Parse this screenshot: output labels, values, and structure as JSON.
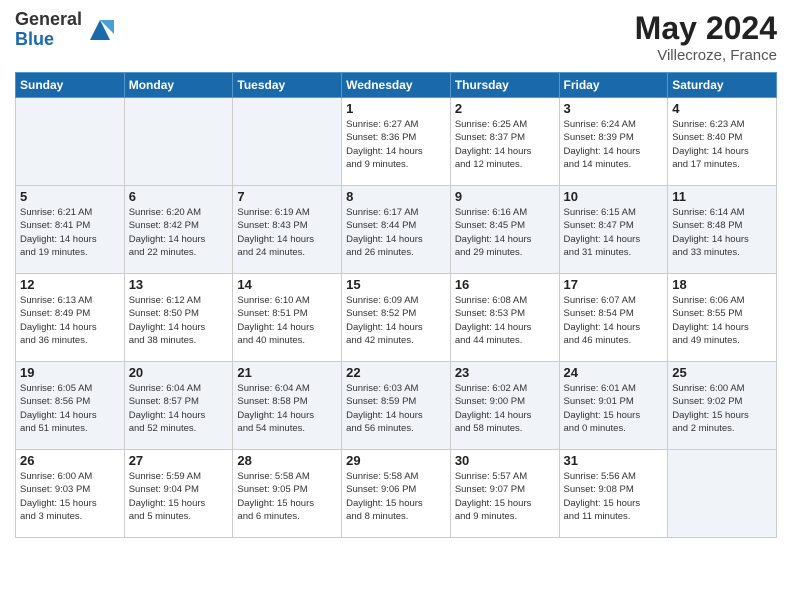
{
  "logo": {
    "general": "General",
    "blue": "Blue"
  },
  "header": {
    "month": "May 2024",
    "location": "Villecroze, France"
  },
  "days_of_week": [
    "Sunday",
    "Monday",
    "Tuesday",
    "Wednesday",
    "Thursday",
    "Friday",
    "Saturday"
  ],
  "weeks": [
    [
      {
        "day": "",
        "info": ""
      },
      {
        "day": "",
        "info": ""
      },
      {
        "day": "",
        "info": ""
      },
      {
        "day": "1",
        "info": "Sunrise: 6:27 AM\nSunset: 8:36 PM\nDaylight: 14 hours\nand 9 minutes."
      },
      {
        "day": "2",
        "info": "Sunrise: 6:25 AM\nSunset: 8:37 PM\nDaylight: 14 hours\nand 12 minutes."
      },
      {
        "day": "3",
        "info": "Sunrise: 6:24 AM\nSunset: 8:39 PM\nDaylight: 14 hours\nand 14 minutes."
      },
      {
        "day": "4",
        "info": "Sunrise: 6:23 AM\nSunset: 8:40 PM\nDaylight: 14 hours\nand 17 minutes."
      }
    ],
    [
      {
        "day": "5",
        "info": "Sunrise: 6:21 AM\nSunset: 8:41 PM\nDaylight: 14 hours\nand 19 minutes."
      },
      {
        "day": "6",
        "info": "Sunrise: 6:20 AM\nSunset: 8:42 PM\nDaylight: 14 hours\nand 22 minutes."
      },
      {
        "day": "7",
        "info": "Sunrise: 6:19 AM\nSunset: 8:43 PM\nDaylight: 14 hours\nand 24 minutes."
      },
      {
        "day": "8",
        "info": "Sunrise: 6:17 AM\nSunset: 8:44 PM\nDaylight: 14 hours\nand 26 minutes."
      },
      {
        "day": "9",
        "info": "Sunrise: 6:16 AM\nSunset: 8:45 PM\nDaylight: 14 hours\nand 29 minutes."
      },
      {
        "day": "10",
        "info": "Sunrise: 6:15 AM\nSunset: 8:47 PM\nDaylight: 14 hours\nand 31 minutes."
      },
      {
        "day": "11",
        "info": "Sunrise: 6:14 AM\nSunset: 8:48 PM\nDaylight: 14 hours\nand 33 minutes."
      }
    ],
    [
      {
        "day": "12",
        "info": "Sunrise: 6:13 AM\nSunset: 8:49 PM\nDaylight: 14 hours\nand 36 minutes."
      },
      {
        "day": "13",
        "info": "Sunrise: 6:12 AM\nSunset: 8:50 PM\nDaylight: 14 hours\nand 38 minutes."
      },
      {
        "day": "14",
        "info": "Sunrise: 6:10 AM\nSunset: 8:51 PM\nDaylight: 14 hours\nand 40 minutes."
      },
      {
        "day": "15",
        "info": "Sunrise: 6:09 AM\nSunset: 8:52 PM\nDaylight: 14 hours\nand 42 minutes."
      },
      {
        "day": "16",
        "info": "Sunrise: 6:08 AM\nSunset: 8:53 PM\nDaylight: 14 hours\nand 44 minutes."
      },
      {
        "day": "17",
        "info": "Sunrise: 6:07 AM\nSunset: 8:54 PM\nDaylight: 14 hours\nand 46 minutes."
      },
      {
        "day": "18",
        "info": "Sunrise: 6:06 AM\nSunset: 8:55 PM\nDaylight: 14 hours\nand 49 minutes."
      }
    ],
    [
      {
        "day": "19",
        "info": "Sunrise: 6:05 AM\nSunset: 8:56 PM\nDaylight: 14 hours\nand 51 minutes."
      },
      {
        "day": "20",
        "info": "Sunrise: 6:04 AM\nSunset: 8:57 PM\nDaylight: 14 hours\nand 52 minutes."
      },
      {
        "day": "21",
        "info": "Sunrise: 6:04 AM\nSunset: 8:58 PM\nDaylight: 14 hours\nand 54 minutes."
      },
      {
        "day": "22",
        "info": "Sunrise: 6:03 AM\nSunset: 8:59 PM\nDaylight: 14 hours\nand 56 minutes."
      },
      {
        "day": "23",
        "info": "Sunrise: 6:02 AM\nSunset: 9:00 PM\nDaylight: 14 hours\nand 58 minutes."
      },
      {
        "day": "24",
        "info": "Sunrise: 6:01 AM\nSunset: 9:01 PM\nDaylight: 15 hours\nand 0 minutes."
      },
      {
        "day": "25",
        "info": "Sunrise: 6:00 AM\nSunset: 9:02 PM\nDaylight: 15 hours\nand 2 minutes."
      }
    ],
    [
      {
        "day": "26",
        "info": "Sunrise: 6:00 AM\nSunset: 9:03 PM\nDaylight: 15 hours\nand 3 minutes."
      },
      {
        "day": "27",
        "info": "Sunrise: 5:59 AM\nSunset: 9:04 PM\nDaylight: 15 hours\nand 5 minutes."
      },
      {
        "day": "28",
        "info": "Sunrise: 5:58 AM\nSunset: 9:05 PM\nDaylight: 15 hours\nand 6 minutes."
      },
      {
        "day": "29",
        "info": "Sunrise: 5:58 AM\nSunset: 9:06 PM\nDaylight: 15 hours\nand 8 minutes."
      },
      {
        "day": "30",
        "info": "Sunrise: 5:57 AM\nSunset: 9:07 PM\nDaylight: 15 hours\nand 9 minutes."
      },
      {
        "day": "31",
        "info": "Sunrise: 5:56 AM\nSunset: 9:08 PM\nDaylight: 15 hours\nand 11 minutes."
      },
      {
        "day": "",
        "info": ""
      }
    ]
  ]
}
